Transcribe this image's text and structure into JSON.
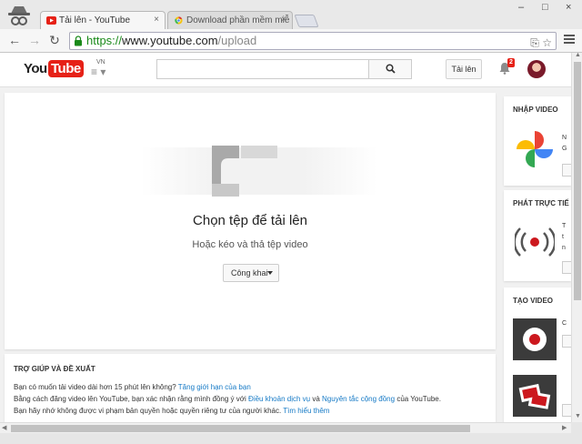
{
  "browser": {
    "tabs": [
      {
        "title": "Tải lên - YouTube",
        "close": "×"
      },
      {
        "title": "Download phần mềm miễ",
        "close": "×"
      }
    ],
    "window_controls": {
      "minimize": "–",
      "maximize": "□",
      "close": "×"
    },
    "nav": {
      "back": "←",
      "forward": "→",
      "reload": "↻"
    },
    "url": {
      "scheme": "https://",
      "host": "www.youtube.com",
      "path": "/upload"
    },
    "omni_icons": "⎘ ☆"
  },
  "masthead": {
    "logo_you": "You",
    "logo_tube": "Tube",
    "logo_region": "VN",
    "guide_icon": "≡ ▾",
    "upload_button": "Tải lên",
    "notification_count": "2"
  },
  "upload": {
    "title": "Chọn tệp để tải lên",
    "subtitle": "Hoặc kéo và thả tệp video",
    "privacy_selected": "Công khai"
  },
  "help": {
    "title": "TRỢ GIÚP VÀ ĐỀ XUẤT",
    "line1_text": "Bạn có muốn tải video dài hơn 15 phút lên không?",
    "line1_link": "Tăng giới hạn của bạn",
    "line2_text_a": "Bằng cách đăng video lên YouTube, bạn xác nhận rằng mình đồng ý với",
    "line2_link_a": "Điều khoản dịch vụ",
    "line2_and": "và",
    "line2_link_b": "Nguyên tắc cộng đồng",
    "line2_text_b": "của YouTube.",
    "line3_text": "Bạn hãy nhớ không được vi phạm bản quyền hoặc quyền riêng tư của người khác.",
    "line3_link": "Tìm hiểu thêm"
  },
  "sidebar": {
    "import_title": "NHẬP VIDEO",
    "import_cut": "N\nG",
    "live_title": "PHÁT TRỰC TIẾ",
    "live_cut": "T\nt\nn",
    "create_title": "TẠO VIDEO",
    "create_cut": "C"
  },
  "colors": {
    "youtube_red": "#e62117",
    "link_blue": "#167ac6",
    "url_green": "#1a8a1a"
  }
}
